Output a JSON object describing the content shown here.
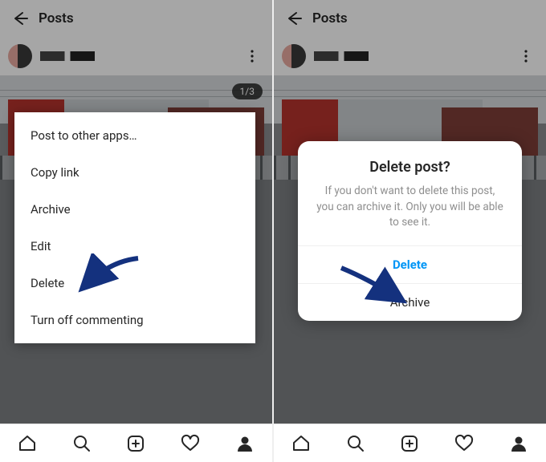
{
  "left": {
    "header": {
      "title": "Posts"
    },
    "carousel_indicator": "1/3",
    "menu": {
      "items": [
        "Post to other apps…",
        "Copy link",
        "Archive",
        "Edit",
        "Delete",
        "Turn off commenting"
      ]
    }
  },
  "right": {
    "header": {
      "title": "Posts"
    },
    "dialog": {
      "title": "Delete post?",
      "text": "If you don't want to delete this post, you can archive it. Only you will be able to see it.",
      "delete_label": "Delete",
      "archive_label": "Archive"
    }
  }
}
